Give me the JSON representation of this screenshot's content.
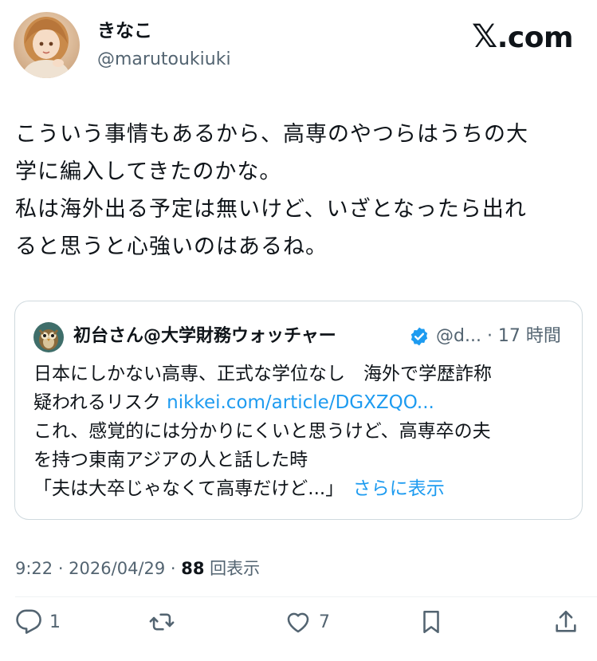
{
  "author": {
    "display_name": "きなこ",
    "handle": "@marutoukiuki"
  },
  "brand": {
    "mark": "𝕏",
    "suffix": ".com"
  },
  "tweet": {
    "lines": [
      "こういう事情もあるから、高専のやつらはうちの大",
      "学に編入してきたのかな。",
      "私は海外出る予定は無いけど、いざとなったら出れ",
      "ると思うと心強いのはあるね。"
    ]
  },
  "quote": {
    "author_name": "初台さん@大学財務ウォッチャー",
    "meta": "@d... · 17 時間",
    "line1": "日本にしかない高専、正式な学位なし　海外で学歴詐称",
    "line2_text": "疑われるリスク ",
    "line2_link": "nikkei.com/article/DGXZQO...",
    "line3": "これ、感覚的には分かりにくいと思うけど、高専卒の夫",
    "line4": "を持つ東南アジアの人と話した時",
    "line5_text": "「夫は大卒じゃなくて高専だけど...」",
    "show_more": "さらに表示"
  },
  "meta": {
    "time_date": "9:22 · 2026/04/29 · ",
    "views": "88",
    "views_label": " 回表示"
  },
  "actions": {
    "reply_icon": "reply-icon",
    "reply_count": "1",
    "retweet_icon": "retweet-icon",
    "like_icon": "heart-icon",
    "like_count": "7",
    "bookmark_icon": "bookmark-icon",
    "share_icon": "share-icon"
  },
  "colors": {
    "text": "#0f1419",
    "secondary": "#536471",
    "link": "#1d9bf0",
    "border": "#cfd9de"
  }
}
